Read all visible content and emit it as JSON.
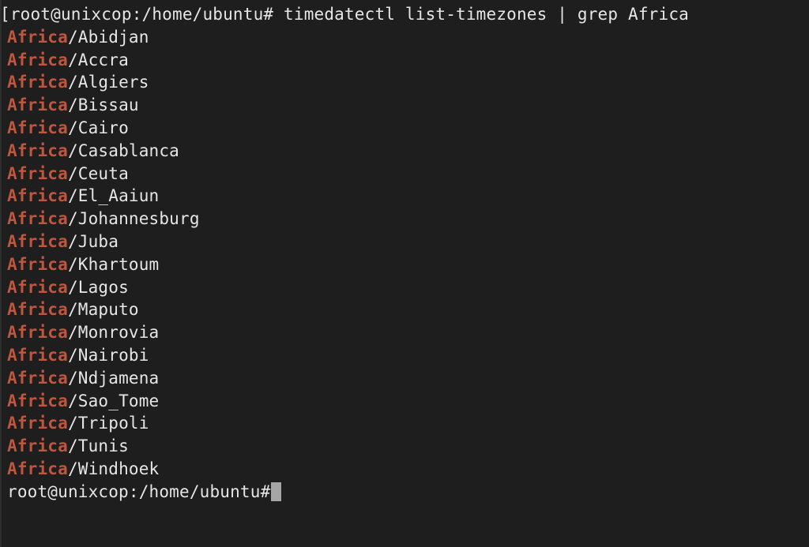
{
  "terminal": {
    "background_color": "#1e1e1e",
    "foreground_color": "#e6e6e6",
    "match_highlight_color": "#c1563f",
    "cursor_color": "#a6a6a6",
    "prompt": "root@unixcop:/home/ubuntu#",
    "leading_bracket": "[",
    "command": "timedatectl list-timezones | grep Africa",
    "command_line_full": "[root@unixcop:/home/ubuntu# timedatectl list-timezones | grep Africa",
    "match_token": "Africa",
    "separator": "/",
    "output_lines": [
      {
        "match": "Africa",
        "rest": "/Abidjan"
      },
      {
        "match": "Africa",
        "rest": "/Accra"
      },
      {
        "match": "Africa",
        "rest": "/Algiers"
      },
      {
        "match": "Africa",
        "rest": "/Bissau"
      },
      {
        "match": "Africa",
        "rest": "/Cairo"
      },
      {
        "match": "Africa",
        "rest": "/Casablanca"
      },
      {
        "match": "Africa",
        "rest": "/Ceuta"
      },
      {
        "match": "Africa",
        "rest": "/El_Aaiun"
      },
      {
        "match": "Africa",
        "rest": "/Johannesburg"
      },
      {
        "match": "Africa",
        "rest": "/Juba"
      },
      {
        "match": "Africa",
        "rest": "/Khartoum"
      },
      {
        "match": "Africa",
        "rest": "/Lagos"
      },
      {
        "match": "Africa",
        "rest": "/Maputo"
      },
      {
        "match": "Africa",
        "rest": "/Monrovia"
      },
      {
        "match": "Africa",
        "rest": "/Nairobi"
      },
      {
        "match": "Africa",
        "rest": "/Ndjamena"
      },
      {
        "match": "Africa",
        "rest": "/Sao_Tome"
      },
      {
        "match": "Africa",
        "rest": "/Tripoli"
      },
      {
        "match": "Africa",
        "rest": "/Tunis"
      },
      {
        "match": "Africa",
        "rest": "/Windhoek"
      }
    ],
    "final_prompt": "root@unixcop:/home/ubuntu#",
    "final_input_value": ""
  }
}
